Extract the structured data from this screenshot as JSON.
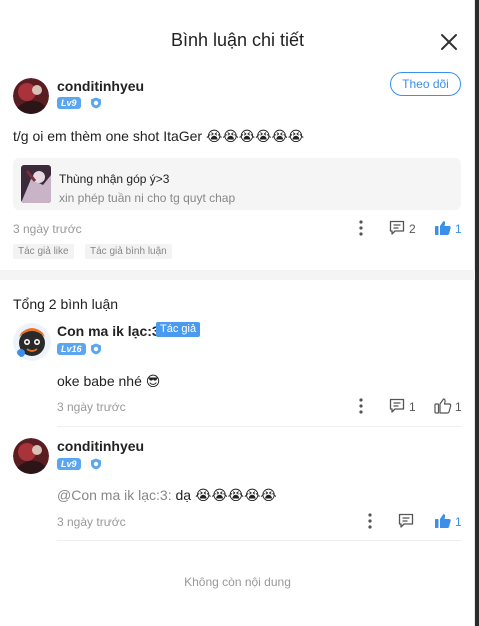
{
  "header": {
    "title": "Bình luận chi tiết"
  },
  "post": {
    "username": "conditinhyeu",
    "level": "Lv9",
    "follow_label": "Theo dõi",
    "text": "t/g oi em thèm one shot ItaGer",
    "emojis": [
      "😭",
      "😭",
      "😭",
      "😭",
      "😭",
      "😭"
    ],
    "ref_card": {
      "title": "Thùng nhận góp ý>3",
      "subtitle": "xin phép tuần ni cho tg quyt chap"
    },
    "time": "3 ngày trước",
    "comment_count": "2",
    "like_count": "1",
    "tags": [
      "Tác giả like",
      "Tác giả bình luận"
    ]
  },
  "total_label": "Tổng 2 bình luận",
  "comments": [
    {
      "username": "Con ma ik lạc:3",
      "author_tag": "Tác giả",
      "level": "Lv16",
      "text": "oke babe nhé",
      "emoji": "😎",
      "time": "3 ngày trước",
      "comment_count": "1",
      "like_count": "1"
    },
    {
      "username": "conditinhyeu",
      "level": "Lv9",
      "mention": "@Con ma ik lạc:3:",
      "text": "dạ",
      "emojis": [
        "😭",
        "😭",
        "😭",
        "😭",
        "😭"
      ],
      "time": "3 ngày trước",
      "like_count": "1"
    }
  ],
  "end_text": "Không còn nội dung",
  "colors": {
    "accent": "#3b8fe8",
    "level_badge": "#5aa6f0",
    "muted": "#999999"
  }
}
